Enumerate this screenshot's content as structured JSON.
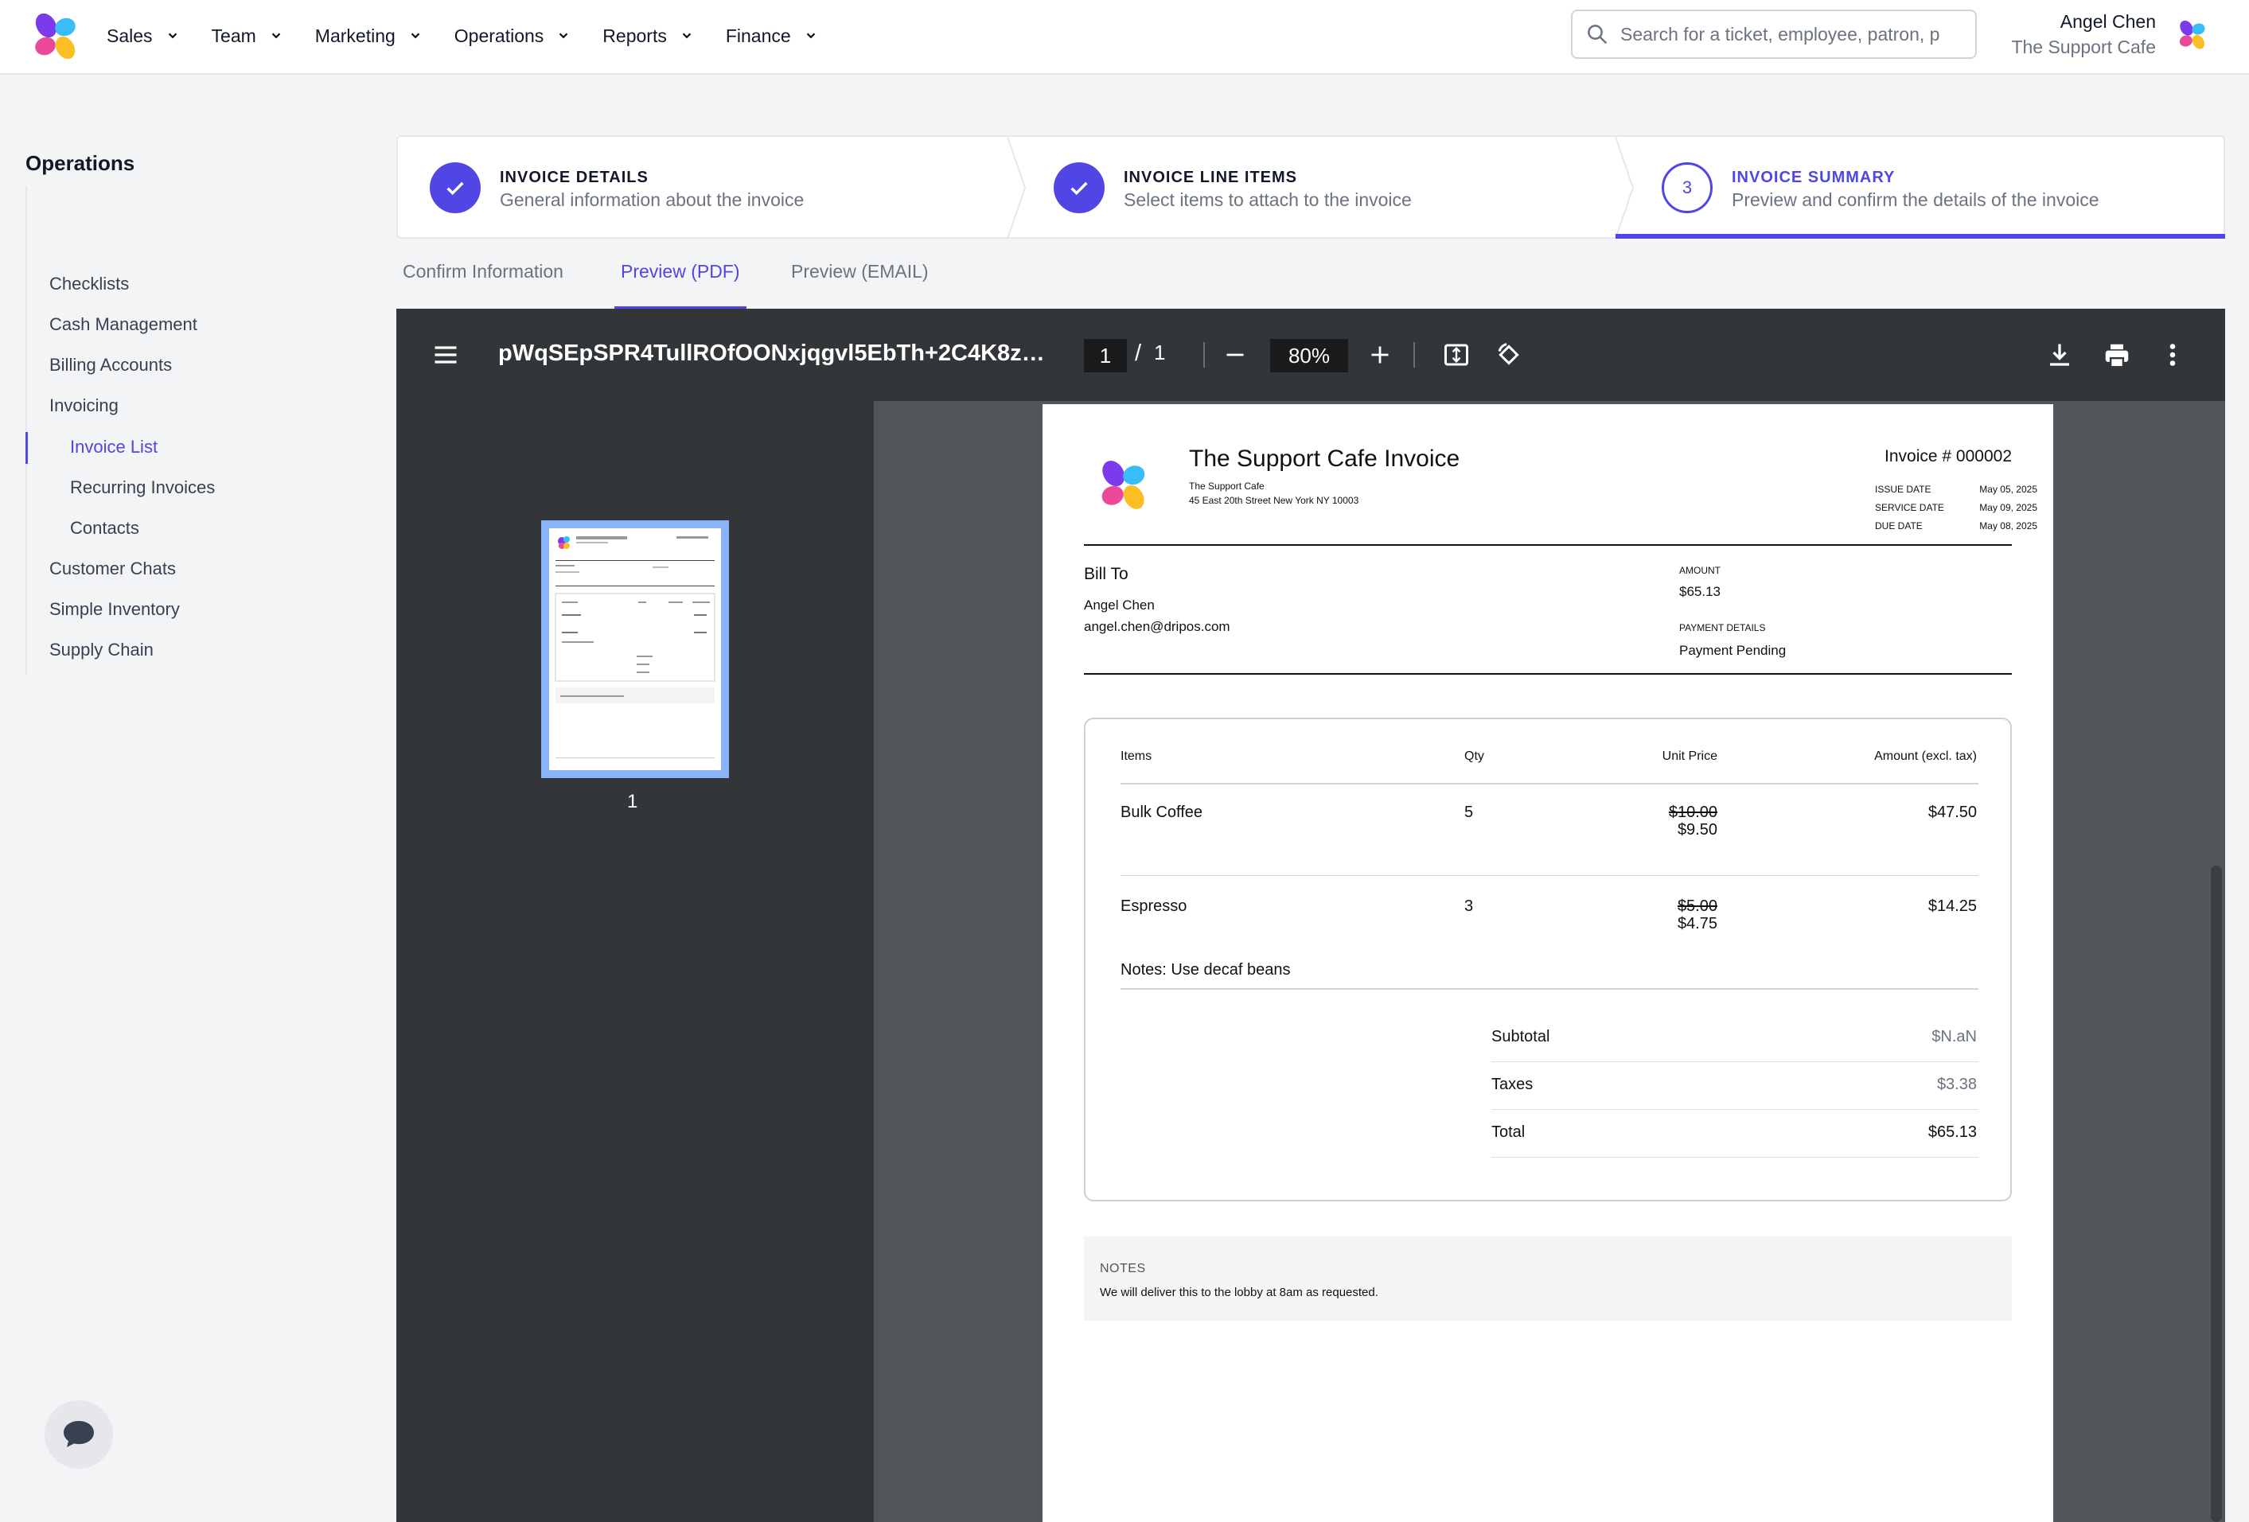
{
  "nav": {
    "items": [
      {
        "label": "Sales"
      },
      {
        "label": "Team"
      },
      {
        "label": "Marketing"
      },
      {
        "label": "Operations"
      },
      {
        "label": "Reports"
      },
      {
        "label": "Finance"
      }
    ],
    "search_placeholder": "Search for a ticket, employee, patron, p",
    "user_name": "Angel Chen",
    "user_org": "The Support Cafe"
  },
  "sidebar": {
    "title": "Operations",
    "items": [
      {
        "label": "Checklists"
      },
      {
        "label": "Cash Management"
      },
      {
        "label": "Billing Accounts"
      },
      {
        "label": "Invoicing"
      },
      {
        "label": "Invoice List"
      },
      {
        "label": "Recurring Invoices"
      },
      {
        "label": "Contacts"
      },
      {
        "label": "Customer Chats"
      },
      {
        "label": "Simple Inventory"
      },
      {
        "label": "Supply Chain"
      }
    ]
  },
  "steps": [
    {
      "title": "INVOICE DETAILS",
      "subtitle": "General information about the invoice",
      "status": "complete"
    },
    {
      "title": "INVOICE LINE ITEMS",
      "subtitle": "Select items to attach to the invoice",
      "status": "complete"
    },
    {
      "title": "INVOICE SUMMARY",
      "subtitle": "Preview and confirm the details of the invoice",
      "status": "current",
      "number": "3"
    }
  ],
  "tabs": [
    {
      "label": "Confirm Information"
    },
    {
      "label": "Preview (PDF)"
    },
    {
      "label": "Preview (EMAIL)"
    }
  ],
  "viewer": {
    "filename": "pWqSEpSPR4TullROfOONxjqgvl5EbTh+2C4K8z8pf...",
    "page_current": "1",
    "page_sep": "/",
    "page_total": "1",
    "zoom": "80%",
    "thumb_label": "1"
  },
  "invoice": {
    "title": "The Support Cafe Invoice",
    "org": "The Support Cafe",
    "address": "45 East 20th Street New York NY 10003",
    "number": "Invoice # 000002",
    "dates": [
      {
        "label": "ISSUE DATE",
        "value": "May 05, 2025"
      },
      {
        "label": "SERVICE DATE",
        "value": "May 09, 2025"
      },
      {
        "label": "DUE DATE",
        "value": "May 08, 2025"
      }
    ],
    "bill_to_label": "Bill To",
    "customer_name": "Angel Chen",
    "customer_email": "angel.chen@dripos.com",
    "amount_label": "AMOUNT",
    "amount_value": "$65.13",
    "payment_label": "PAYMENT DETAILS",
    "payment_value": "Payment Pending",
    "table": {
      "headers": [
        "Items",
        "Qty",
        "Unit Price",
        "Amount (excl. tax)"
      ],
      "rows": [
        {
          "item": "Bulk Coffee",
          "qty": "5",
          "old_price": "$10.00",
          "price": "$9.50",
          "amount": "$47.50"
        },
        {
          "item": "Espresso",
          "qty": "3",
          "old_price": "$5.00",
          "price": "$4.75",
          "amount": "$14.25",
          "note": "Notes: Use decaf beans"
        }
      ]
    },
    "totals": [
      {
        "label": "Subtotal",
        "value": "$N.aN"
      },
      {
        "label": "Taxes",
        "value": "$3.38"
      },
      {
        "label": "Total",
        "value": "$65.13"
      }
    ],
    "notes_label": "NOTES",
    "notes_text": "We will deliver this to the lobby at 8am as requested."
  },
  "colors": {
    "accent": "#4f46e5",
    "viewer_bg": "#525659",
    "viewer_toolbar": "#323639"
  }
}
